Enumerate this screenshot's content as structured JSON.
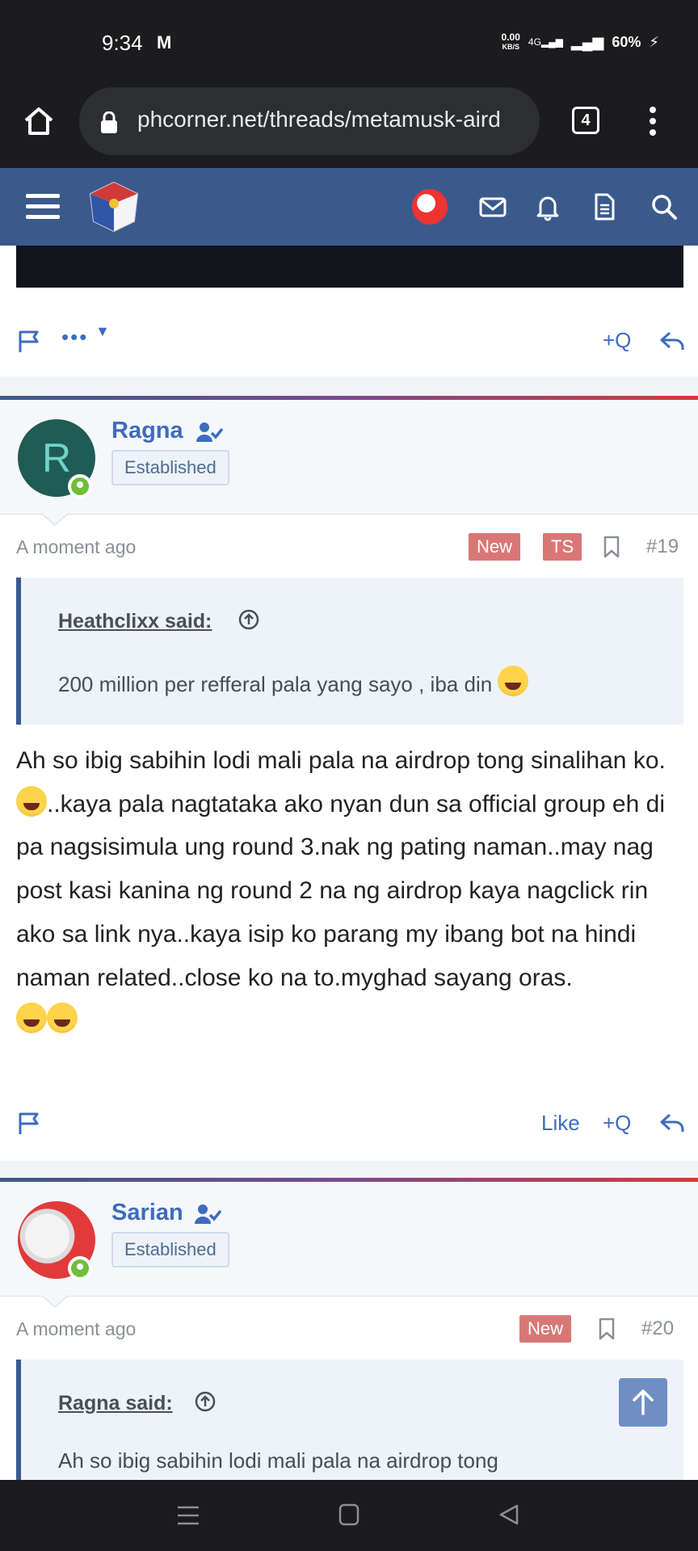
{
  "status_bar": {
    "time": "9:34",
    "mail_icon": "gmail-icon",
    "speed": "0.00",
    "speed_unit": "KB/S",
    "network": "4G",
    "battery": "60%"
  },
  "browser": {
    "url": "phcorner.net/threads/metamusk-aird",
    "tab_count": "4"
  },
  "site_header": {
    "icons": [
      "menu-icon",
      "logo-icon",
      "avatar-icon",
      "mail-icon",
      "bell-icon",
      "document-icon",
      "search-icon"
    ]
  },
  "top_actions": {
    "more": "•••"
  },
  "posts": [
    {
      "username": "Ragna",
      "avatar_letter": "R",
      "avatar_color": "#1e5c55",
      "user_title": "Established",
      "time": "A moment ago",
      "badges": [
        "New",
        "TS"
      ],
      "post_number": "#19",
      "quote_author": "Heathclixx said:",
      "quote_text": "200 million per refferal pala yang sayo , iba din",
      "body_part1": "Ah so ibig sabihin lodi mali pala na airdrop tong sinalihan ko.",
      "body_part2": "..kaya pala nagtataka ako nyan dun sa official group eh di pa nagsisimula ung round 3.nak ng pating naman..may nag post kasi kanina ng round 2 na ng airdrop kaya nagclick rin ako sa link nya..kaya isip ko parang my ibang bot na hindi naman related..close ko na to.myghad sayang oras.",
      "like_label": "Like",
      "quote_label": "+Q"
    },
    {
      "username": "Sarian",
      "user_title": "Established",
      "time": "A moment ago",
      "badges": [
        "New"
      ],
      "post_number": "#20",
      "quote_author": "Ragna said:",
      "quote_text": "Ah so ibig sabihin lodi mali pala na airdrop tong"
    }
  ],
  "colors": {
    "header": "#3a5a8c",
    "link": "#3d6cbf",
    "badge": "#d97777",
    "online": "#6fbf3a"
  }
}
